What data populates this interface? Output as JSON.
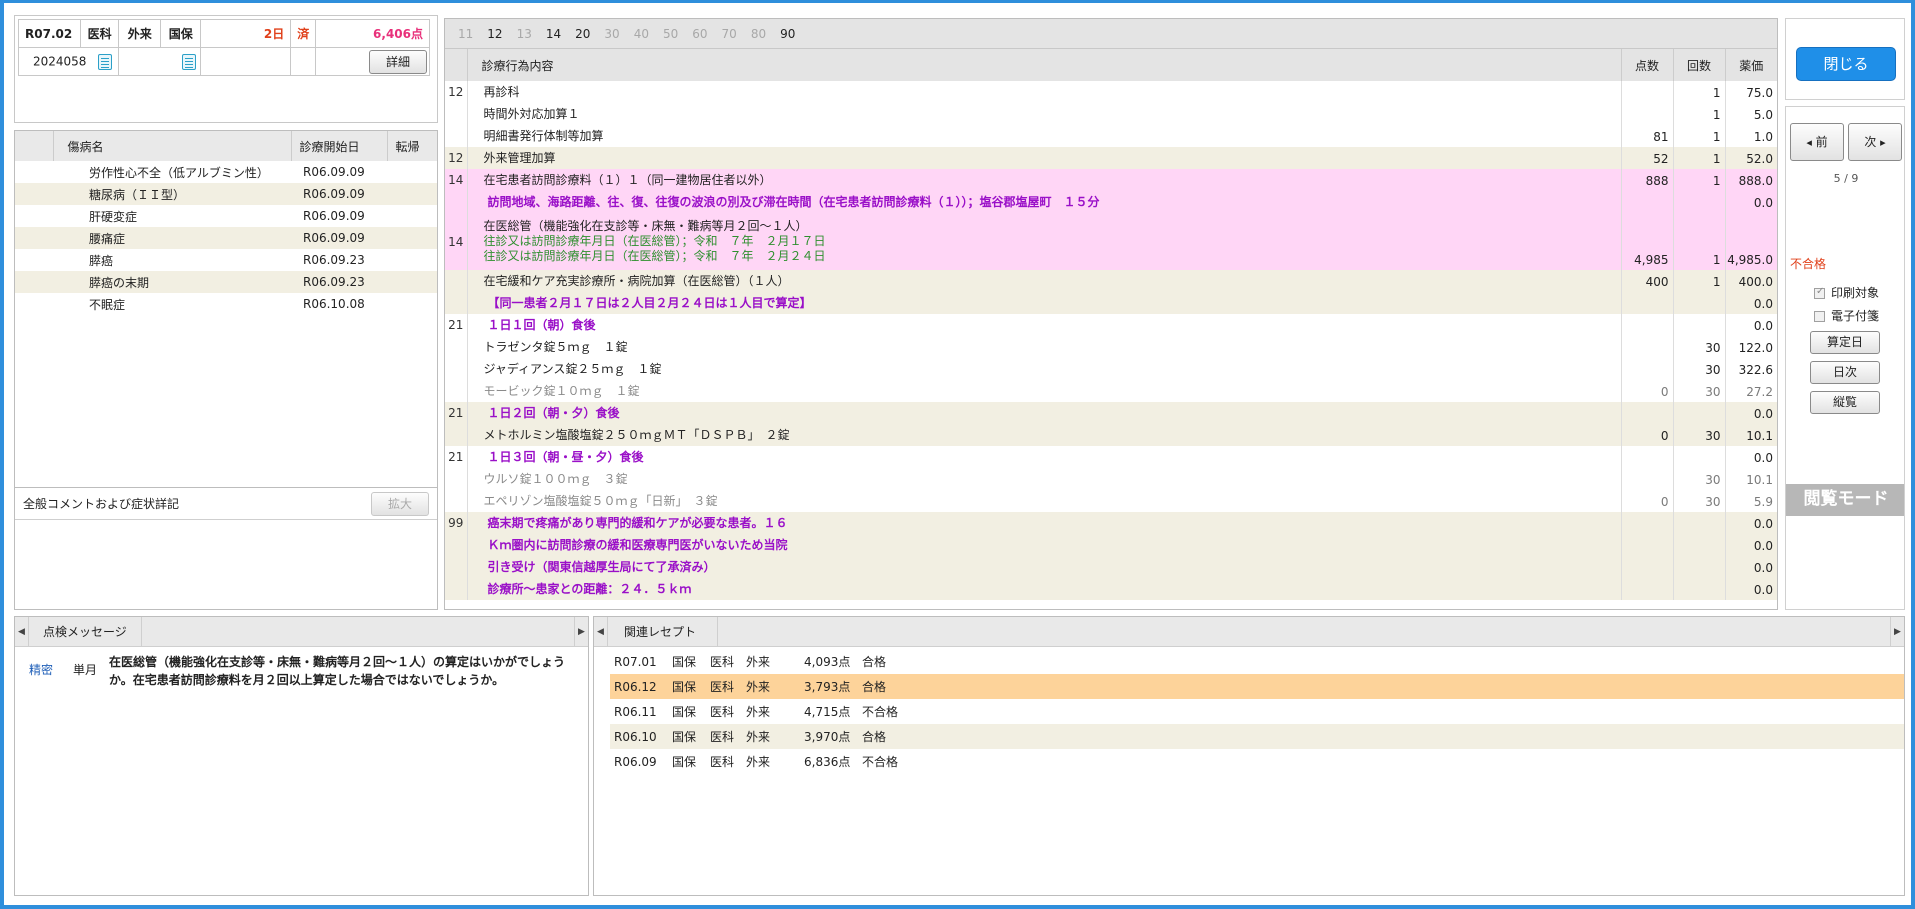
{
  "header": {
    "era": "R07.02",
    "dept": "医科",
    "visit": "外来",
    "insurance": "国保",
    "days": "2日",
    "status": "済",
    "points": "6,406点",
    "patient_id": "2024058",
    "detail_label": "詳細"
  },
  "diseases": {
    "columns": [
      "傷病名",
      "診療開始日",
      "転帰"
    ],
    "rows": [
      {
        "name": "労作性心不全（低アルブミン性）",
        "date": "R06.09.09"
      },
      {
        "name": "糖尿病（ＩＩ型）",
        "date": "R06.09.09"
      },
      {
        "name": "肝硬変症",
        "date": "R06.09.09"
      },
      {
        "name": "腰痛症",
        "date": "R06.09.09"
      },
      {
        "name": "膵癌",
        "date": "R06.09.23"
      },
      {
        "name": "膵癌の末期",
        "date": "R06.09.23"
      },
      {
        "name": "不眠症",
        "date": "R06.10.08"
      }
    ]
  },
  "comment": {
    "title": "全般コメントおよび症状詳記",
    "expand_label": "拡大"
  },
  "main": {
    "tabs": [
      {
        "label": "11",
        "active": false
      },
      {
        "label": "12",
        "active": true
      },
      {
        "label": "13",
        "active": false
      },
      {
        "label": "14",
        "active": true
      },
      {
        "label": "20",
        "active": true
      },
      {
        "label": "30",
        "active": false
      },
      {
        "label": "40",
        "active": false
      },
      {
        "label": "50",
        "active": false
      },
      {
        "label": "60",
        "active": false
      },
      {
        "label": "70",
        "active": false
      },
      {
        "label": "80",
        "active": false
      },
      {
        "label": "90",
        "active": true
      }
    ],
    "columns": {
      "content": "診療行為内容",
      "points": "点数",
      "count": "回数",
      "price": "薬価"
    },
    "rows": [
      {
        "code": "12",
        "bg": "wt",
        "lines": [
          {
            "t": "再診科",
            "s": ""
          }
        ],
        "points": "",
        "count": "1",
        "price": "75.0"
      },
      {
        "code": "",
        "bg": "wt",
        "lines": [
          {
            "t": "時間外対応加算１",
            "s": ""
          }
        ],
        "points": "",
        "count": "1",
        "price": "5.0"
      },
      {
        "code": "",
        "bg": "wt",
        "lines": [
          {
            "t": "明細書発行体制等加算",
            "s": ""
          }
        ],
        "points": "81",
        "count": "1",
        "price": "1.0"
      },
      {
        "code": "12",
        "bg": "bg",
        "lines": [
          {
            "t": "外来管理加算",
            "s": ""
          }
        ],
        "points": "52",
        "count": "1",
        "price": "52.0"
      },
      {
        "code": "14",
        "bg": "pk",
        "lines": [
          {
            "t": "在宅患者訪問診療料（１）１（同一建物居住者以外）",
            "s": ""
          }
        ],
        "points": "888",
        "count": "1",
        "price": "888.0"
      },
      {
        "code": "",
        "bg": "pk",
        "lines": [
          {
            "t": "訪問地域、海路距離、往、復、往復の波浪の別及び滞在時間（在宅患者訪問診療料（１））；塩谷郡塩屋町　１５分",
            "s": "pur"
          }
        ],
        "points": "",
        "count": "",
        "price": "0.0"
      },
      {
        "code": "14",
        "bg": "pk",
        "lines": [
          {
            "t": "在医総管（機能強化在支診等・床無・難病等月２回〜１人）",
            "s": ""
          },
          {
            "t": "往診又は訪問診療年月日（在医総管）；令和　７年　２月１７日",
            "s": "grn"
          },
          {
            "t": "往診又は訪問診療年月日（在医総管）；令和　７年　２月２４日",
            "s": "grn"
          }
        ],
        "points": "4,985",
        "count": "1",
        "price": "4,985.0"
      },
      {
        "code": "",
        "bg": "bg",
        "lines": [
          {
            "t": "在宅緩和ケア充実診療所・病院加算（在医総管）（１人）",
            "s": ""
          }
        ],
        "points": "400",
        "count": "1",
        "price": "400.0"
      },
      {
        "code": "",
        "bg": "bg",
        "lines": [
          {
            "t": "【同一患者２月１７日は２人目２月２４日は１人目で算定】",
            "s": "pur"
          }
        ],
        "points": "",
        "count": "",
        "price": "0.0"
      },
      {
        "code": "21",
        "bg": "wt",
        "lines": [
          {
            "t": "１日１回（朝）食後",
            "s": "pur"
          }
        ],
        "points": "",
        "count": "",
        "price": "0.0"
      },
      {
        "code": "",
        "bg": "wt",
        "lines": [
          {
            "t": "トラゼンタ錠５ｍｇ　１錠",
            "s": ""
          }
        ],
        "points": "",
        "count": "30",
        "price": "122.0"
      },
      {
        "code": "",
        "bg": "wt",
        "lines": [
          {
            "t": "ジャディアンス錠２５ｍｇ　１錠",
            "s": ""
          }
        ],
        "points": "",
        "count": "30",
        "price": "322.6"
      },
      {
        "code": "",
        "bg": "wt",
        "lines": [
          {
            "t": "モービック錠１０ｍｇ　１錠",
            "s": "gry"
          }
        ],
        "points": "0",
        "count": "30",
        "price": "27.2",
        "dim": true
      },
      {
        "code": "21",
        "bg": "bg",
        "lines": [
          {
            "t": "１日２回（朝・夕）食後",
            "s": "pur"
          }
        ],
        "points": "",
        "count": "",
        "price": "0.0"
      },
      {
        "code": "",
        "bg": "bg",
        "lines": [
          {
            "t": "メトホルミン塩酸塩錠２５０ｍｇＭＴ「ＤＳＰＢ」　２錠",
            "s": ""
          }
        ],
        "points": "0",
        "count": "30",
        "price": "10.1"
      },
      {
        "code": "21",
        "bg": "wt",
        "lines": [
          {
            "t": "１日３回（朝・昼・夕）食後",
            "s": "pur"
          }
        ],
        "points": "",
        "count": "",
        "price": "0.0"
      },
      {
        "code": "",
        "bg": "wt",
        "lines": [
          {
            "t": "ウルソ錠１００ｍｇ　３錠",
            "s": "gry"
          }
        ],
        "points": "",
        "count": "30",
        "price": "10.1",
        "dim": true
      },
      {
        "code": "",
        "bg": "wt",
        "lines": [
          {
            "t": "エペリゾン塩酸塩錠５０ｍｇ「日新」　３錠",
            "s": "gry"
          }
        ],
        "points": "0",
        "count": "30",
        "price": "5.9",
        "dim": true
      },
      {
        "code": "99",
        "bg": "bg",
        "lines": [
          {
            "t": "癌末期で疼痛があり専門的緩和ケアが必要な患者。１６",
            "s": "pur"
          }
        ],
        "points": "",
        "count": "",
        "price": "0.0"
      },
      {
        "code": "",
        "bg": "bg",
        "lines": [
          {
            "t": "Ｋｍ圏内に訪問診療の緩和医療専門医がいないため当院",
            "s": "pur"
          }
        ],
        "points": "",
        "count": "",
        "price": "0.0"
      },
      {
        "code": "",
        "bg": "bg",
        "lines": [
          {
            "t": "引き受け（関東信越厚生局にて了承済み）",
            "s": "pur"
          }
        ],
        "points": "",
        "count": "",
        "price": "0.0"
      },
      {
        "code": "",
        "bg": "bg",
        "lines": [
          {
            "t": "診療所〜患家との距離：２４．５ｋｍ",
            "s": "pur"
          }
        ],
        "points": "",
        "count": "",
        "price": "0.0"
      }
    ]
  },
  "side": {
    "close_label": "閉じる",
    "prev_label": "前",
    "next_label": "次",
    "page": "5 / 9",
    "result": "不合格",
    "print_label": "印刷対象",
    "esign_label": "電子付箋",
    "calc_day_label": "算定日",
    "daily_label": "日次",
    "overview_label": "縦覧",
    "mode_label": "閲覧モード"
  },
  "check": {
    "tab": "点検メッセージ",
    "rows": [
      {
        "type": "精密",
        "period": "単月",
        "message": "在医総管（機能強化在支診等・床無・難病等月２回〜１人）の算定はいかがでしょうか。在宅患者訪問診療料を月２回以上算定した場合ではないでしょうか。"
      }
    ]
  },
  "related": {
    "tab": "関連レセプト",
    "rows": [
      {
        "era": "R07.01",
        "ins": "国保",
        "dept": "医科",
        "visit": "外来",
        "points": "4,093点",
        "result": "合格"
      },
      {
        "era": "R06.12",
        "ins": "国保",
        "dept": "医科",
        "visit": "外来",
        "points": "3,793点",
        "result": "合格",
        "selected": true
      },
      {
        "era": "R06.11",
        "ins": "国保",
        "dept": "医科",
        "visit": "外来",
        "points": "4,715点",
        "result": "不合格"
      },
      {
        "era": "R06.10",
        "ins": "国保",
        "dept": "医科",
        "visit": "外来",
        "points": "3,970点",
        "result": "合格"
      },
      {
        "era": "R06.09",
        "ins": "国保",
        "dept": "医科",
        "visit": "外来",
        "points": "6,836点",
        "result": "不合格"
      }
    ]
  }
}
